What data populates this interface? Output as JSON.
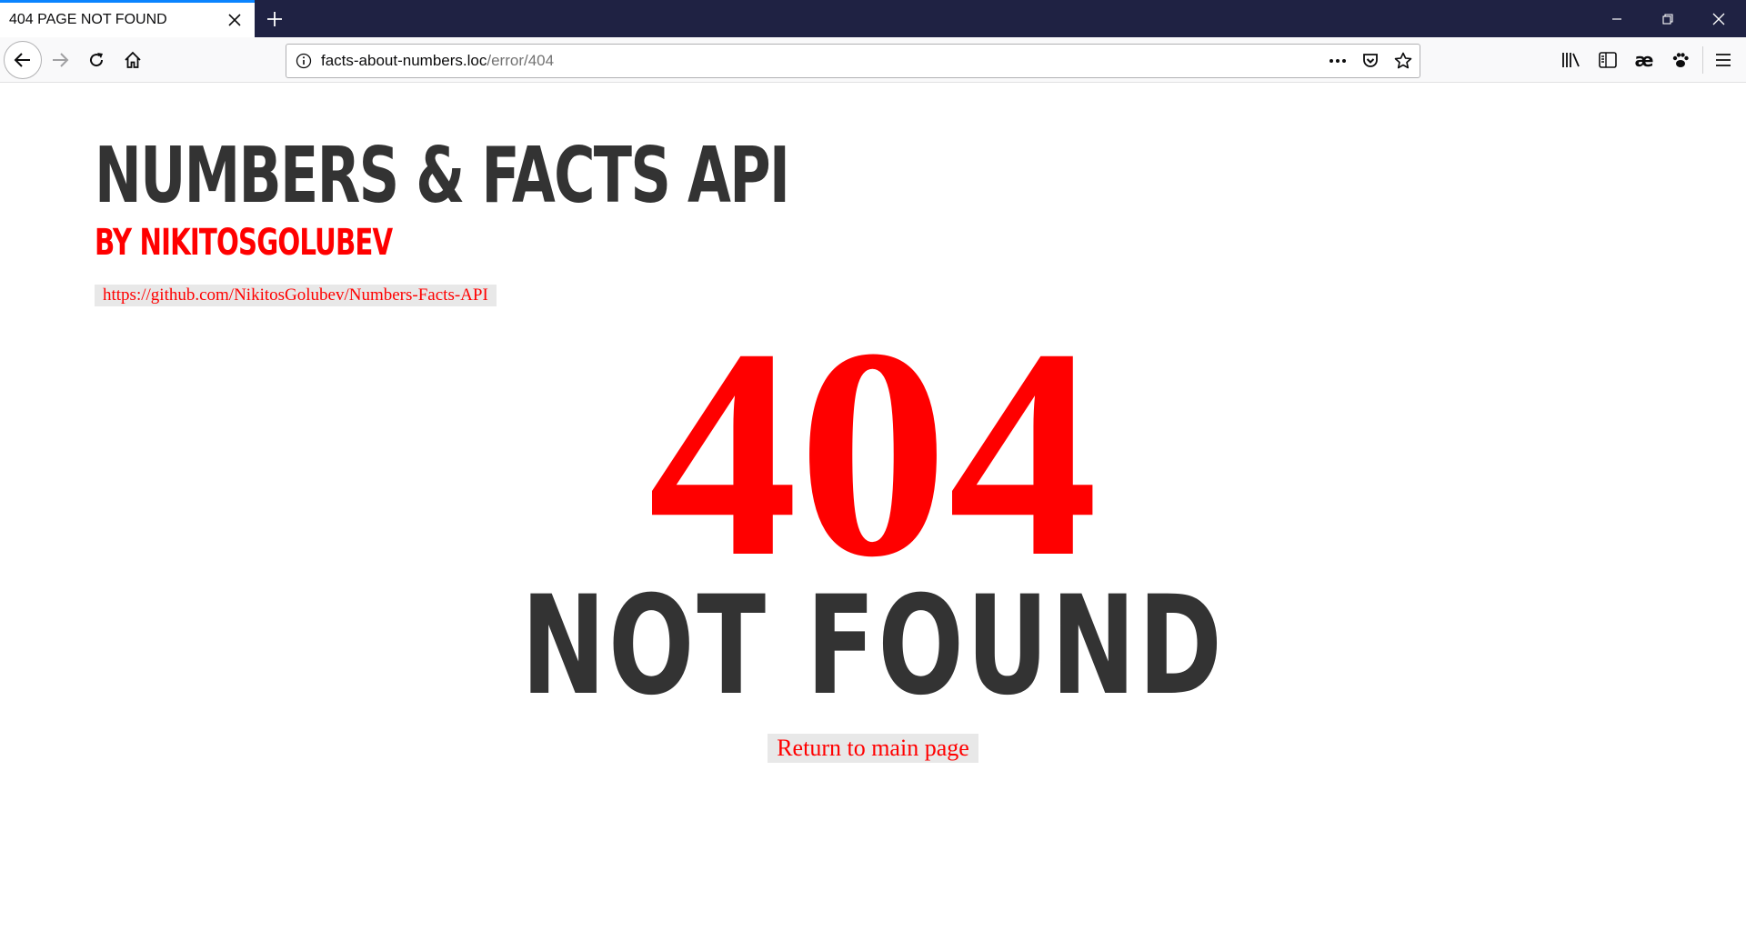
{
  "browser": {
    "tab": {
      "title": "404 PAGE NOT FOUND"
    },
    "url": {
      "host": "facts-about-numbers.loc",
      "path": "/error/404"
    }
  },
  "page": {
    "title": "NUMBERS & FACTS API",
    "subtitle": "BY NIKITOSGOLUBEV",
    "repo_link": "https://github.com/NikitosGolubev/Numbers-Facts-API",
    "error_code": "404",
    "error_text": "NOT FOUND",
    "return_link": "Return to main page"
  },
  "colors": {
    "accent": "#ff0000",
    "text_dark": "#333333",
    "tabstrip_bg": "#1f2243",
    "link_bg": "#e8e8e8"
  }
}
